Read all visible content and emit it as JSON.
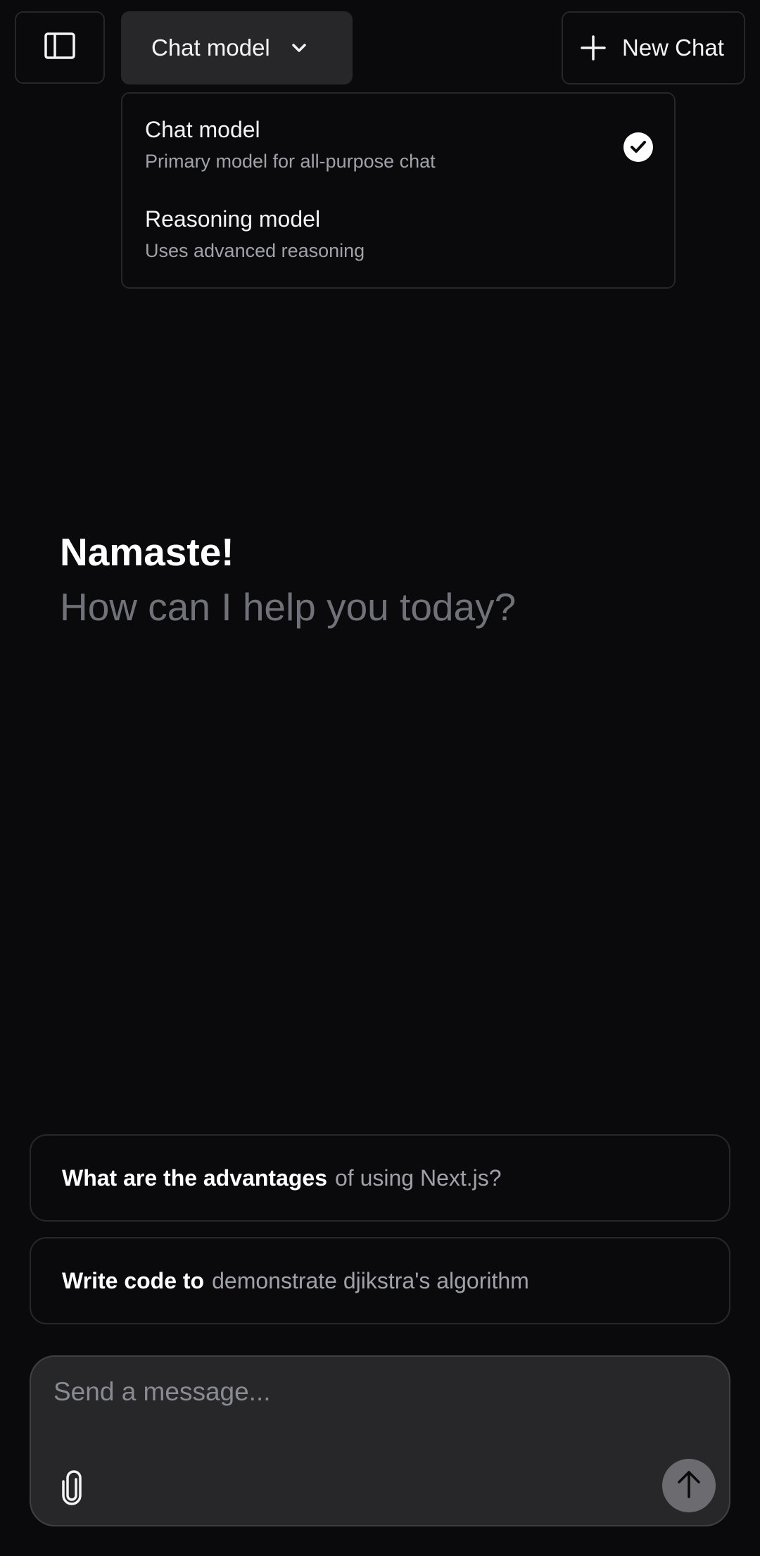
{
  "header": {
    "sidebar_toggle_icon": "sidebar-panel-icon",
    "model_selector_label": "Chat model",
    "new_chat_label": "New Chat"
  },
  "model_dropdown": {
    "items": [
      {
        "title": "Chat model",
        "subtitle": "Primary model for all-purpose chat",
        "selected": true
      },
      {
        "title": "Reasoning model",
        "subtitle": "Uses advanced reasoning",
        "selected": false
      }
    ]
  },
  "greeting": {
    "title": "Namaste!",
    "subtitle": "How can I help you today?"
  },
  "suggestions": [
    {
      "strong": "What are the advantages",
      "rest": "of using Next.js?"
    },
    {
      "strong": "Write code to",
      "rest": "demonstrate djikstra's algorithm"
    }
  ],
  "composer": {
    "placeholder": "Send a message...",
    "attach_icon": "paperclip-icon",
    "send_icon": "arrow-up-icon"
  },
  "colors": {
    "background": "#0a0a0c",
    "surface": "#27272a",
    "border": "#27272a",
    "muted_text": "#a1a1aa",
    "send_button": "#6b6b70"
  }
}
